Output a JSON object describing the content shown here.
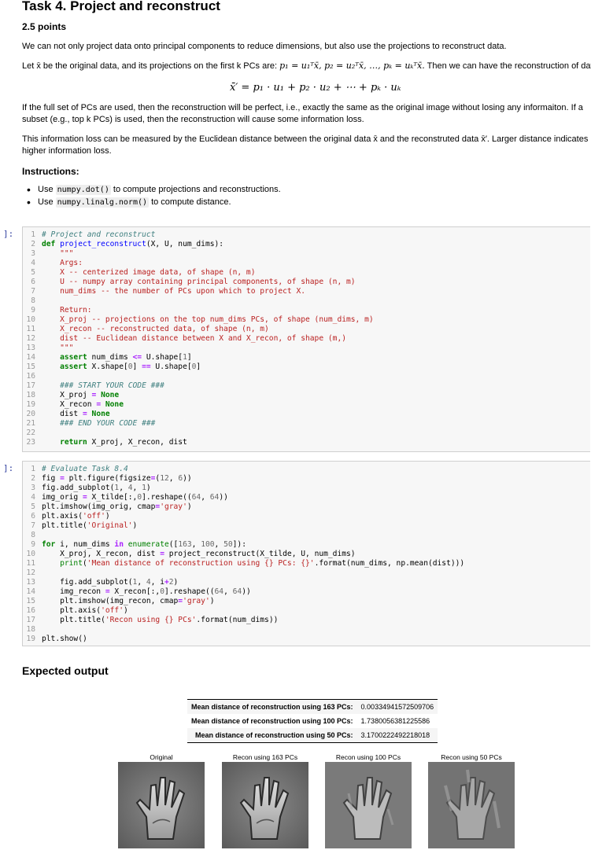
{
  "task": {
    "title": "Task 4. Project and reconstruct",
    "points": "2.5 points",
    "intro": "We can not only project data onto principal components to reduce dimensions, but also use the projections to reconstruct data.",
    "let_line_prefix": "Let x̄ be the original data, and its projections on the first k PCs are:",
    "let_line_eqs": "p₁ = u₁ᵀx̄, p₂ = u₂ᵀx̄, …, pₖ = uₖᵀx̄.",
    "let_line_suffix": "Then we can have the reconstruction of data x̄′ b",
    "formula": "x̄′ = p₁ · u₁ + p₂ · u₂ + ⋯ + pₖ · uₖ",
    "full_set": "If the full set of PCs are used, then the reconstruction will be perfect, i.e., exactly the same as the original image without losing any informaiton. If a subset (e.g., top k PCs) is used, then the reconstruction will cause some information loss.",
    "loss": "This information loss can be measured by the Euclidean distance between the original data x̄ and the reconstruted data x̄′. Larger distance indicates higher information loss.",
    "instructions_label": "Instructions:",
    "bullets": [
      {
        "pre": "Use ",
        "code": "numpy.dot()",
        "post": " to compute projections and reconstructions."
      },
      {
        "pre": "Use ",
        "code": "numpy.linalg.norm()",
        "post": " to compute distance."
      }
    ]
  },
  "cells": {
    "prompt": "]:",
    "cell1_lines": 23,
    "cell2_lines": 19
  },
  "expected": {
    "title": "Expected output",
    "rows": [
      {
        "label": "Mean distance of reconstruction using 163 PCs:",
        "value": "0.00334941572509706"
      },
      {
        "label": "Mean distance of reconstruction using 100 PCs:",
        "value": "1.7380056381225586"
      },
      {
        "label": "Mean distance of reconstruction using 50 PCs:",
        "value": "3.1700222492218018"
      }
    ],
    "panels": [
      "Original",
      "Recon using 163 PCs",
      "Recon using 100 PCs",
      "Recon using 50 PCs"
    ]
  }
}
